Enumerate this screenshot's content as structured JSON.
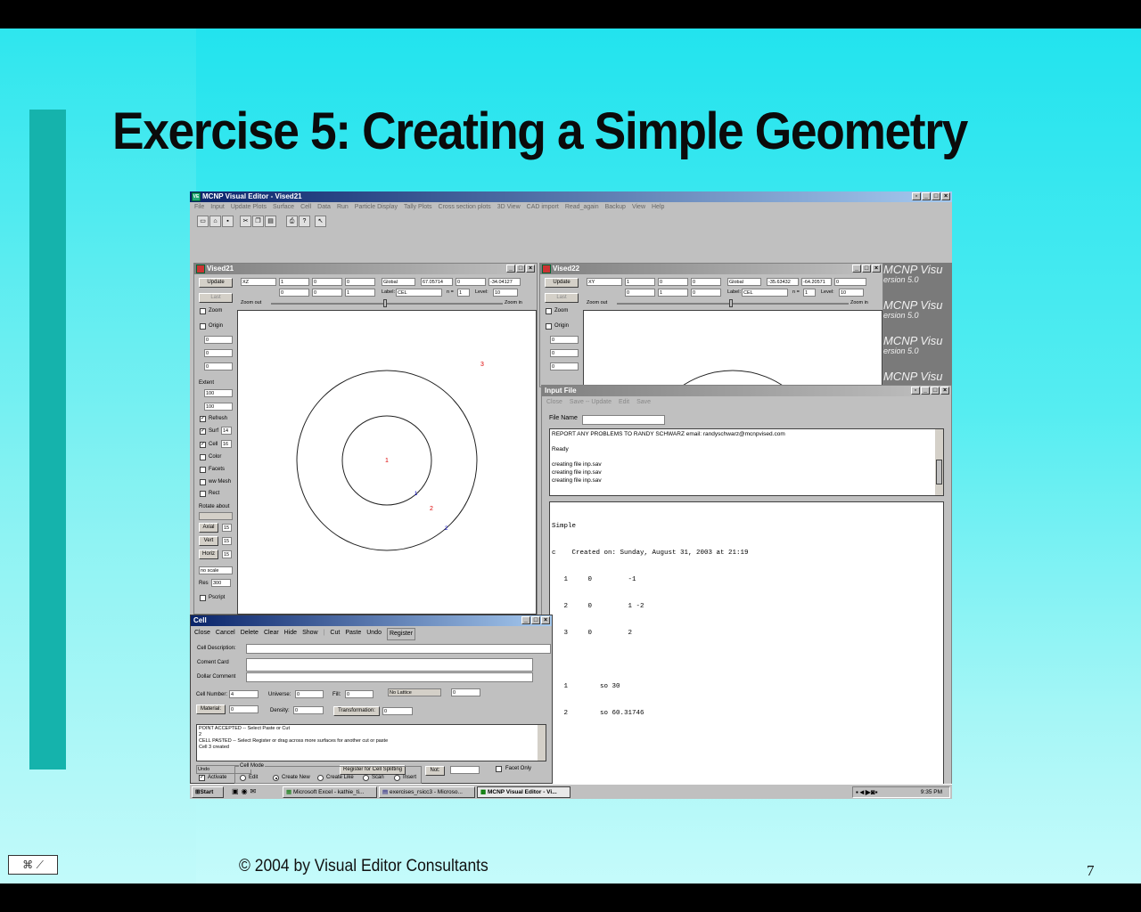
{
  "slide": {
    "title": "Exercise 5:  Creating a Simple Geometry",
    "footer": "© 2004 by Visual Editor Consultants",
    "page_number": "7"
  },
  "app": {
    "title": "MCNP Visual Editor - Vised21",
    "menu": [
      "File",
      "Input",
      "Update Plots",
      "Surface",
      "Cell",
      "Data",
      "Run",
      "Particle Display",
      "Tally Plots",
      "Cross section plots",
      "3D View",
      "CAD import",
      "Read_again",
      "Backup",
      "View",
      "Help"
    ],
    "toolbar_icons": [
      "new-icon",
      "open-icon",
      "save-icon",
      "cut-icon",
      "copy-icon",
      "paste-icon",
      "print-icon",
      "help-icon",
      "context-help-icon"
    ]
  },
  "plot_left": {
    "title": "Vised21",
    "update": "Update",
    "last": "Last",
    "basis": "XZ",
    "row1": [
      "1",
      "0",
      "0"
    ],
    "row2": [
      "0",
      "0",
      "1"
    ],
    "coord": "Global",
    "ext1": "67.05714",
    "ext2": "0",
    "ext3": "-34.04127",
    "label_caption": "Label:",
    "label_value": "CEL",
    "n_caption": "n =",
    "n_value": "1",
    "level_caption": "Level:",
    "level_value": "10",
    "zoom_out": "Zoom out",
    "zoom_in": "Zoom in",
    "zoom": "Zoom",
    "origin": "Origin",
    "origin_vals": [
      "0",
      "0",
      "0"
    ],
    "extent": "Extent",
    "extent_vals": [
      "100",
      "100"
    ],
    "refresh": "Refresh",
    "surf": "Surf",
    "surf_val": "14",
    "cell": "Cell",
    "cell_val": "16",
    "color": "Color",
    "facets": "Facets",
    "ww_mesh": "ww Mesh",
    "rect": "Rect",
    "rotate_about": "Rotate about",
    "axial": "Axial",
    "vert": "Vert",
    "horiz": "Horiz",
    "rot_val": "15",
    "scale": "no scale",
    "res": "Res",
    "res_val": "300",
    "pscript": "Pscript",
    "labels": {
      "cell1": "1",
      "cell2": "2",
      "cell3": "3",
      "surf1": "1",
      "surf2": "2"
    }
  },
  "plot_right": {
    "title": "Vised22",
    "basis": "XY",
    "row1": [
      "1",
      "0",
      "0"
    ],
    "row2": [
      "0",
      "1",
      "0"
    ],
    "coord": "Global",
    "ext1": "-35.63432",
    "ext2": "-64.20571",
    "ext3": "0",
    "label_value": "CEL",
    "n_value": "1",
    "level_value": "10"
  },
  "logo": {
    "line1": "MCNP Visu",
    "line2": "ersion 5.0"
  },
  "input_file": {
    "title": "Input File",
    "menu": [
      "Close",
      "Save -- Update",
      "Edit",
      "Save"
    ],
    "file_name_label": "File Name",
    "messages": [
      "REPORT ANY PROBLEMS TO RANDY SCHWARZ email: randyschwarz@mcnpvised.com",
      "",
      "Ready",
      "",
      "creating file inp.sav",
      "creating file inp.sav",
      "creating file inp.sav"
    ],
    "text": [
      "Simple",
      "c    Created on: Sunday, August 31, 2003 at 21:19",
      "   1     0         -1",
      "   2     0         1 -2",
      "   3     0         2",
      "",
      "   1        so 30",
      "   2        so 60.31746"
    ]
  },
  "cell_window": {
    "title": "Cell",
    "menu": [
      "Close",
      "Cancel",
      "Delete",
      "Clear",
      "Hide",
      "Show",
      "|",
      "Cut",
      "Paste",
      "Undo",
      "Register"
    ],
    "cell_description": "Cell Description:",
    "coment_card": "Coment Card",
    "dollar_comment": "Dollar Comment",
    "cell_number_label": "Cell Number:",
    "cell_number": "4",
    "universe_label": "Universe:",
    "universe": "0",
    "fill_label": "Fill:",
    "fill": "0",
    "lattice": "No Lattice",
    "lattice_val": "0",
    "material": "Material:",
    "material_val": "0",
    "density_label": "Density:",
    "density": "0",
    "transformation": "Transformation:",
    "transformation_val": "0",
    "log": [
      "POINT ACCEPTED -- Select Paste or Cut",
      "2",
      "CELL PASTED -- Select Register or drag across more surfaces for another cut or paste",
      "Cell 3 created"
    ],
    "undo": "Undo",
    "register_split": "Register for Cell Splitting",
    "not": "Not:",
    "facet_only": "Facet Only",
    "activate": "Activate",
    "cell_mode": "Cell Mode",
    "modes": [
      "Edit",
      "Create New",
      "Create Like",
      "Scan",
      "Insert"
    ]
  },
  "taskbar": {
    "start": "Start",
    "tasks": [
      "Microsoft Excel - kathie_ti...",
      "exercises_rsicc3 - Microso...",
      "MCNP Visual Editor - Vi..."
    ],
    "clock": "9:35 PM"
  }
}
